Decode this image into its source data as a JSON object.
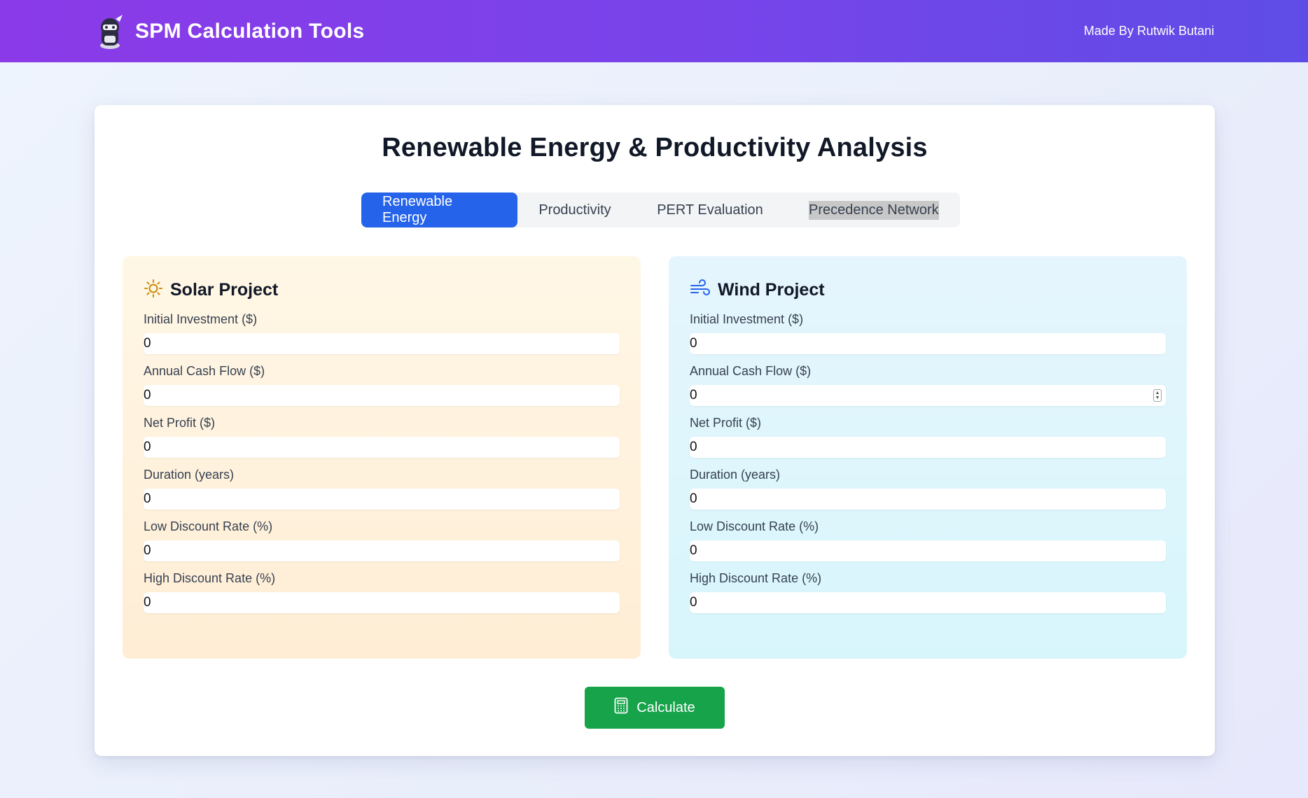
{
  "header": {
    "app_title": "SPM Calculation Tools",
    "made_by": "Made By Rutwik Butani"
  },
  "main": {
    "page_title": "Renewable Energy & Productivity Analysis",
    "tabs": [
      {
        "label": "Renewable Energy",
        "active": true
      },
      {
        "label": "Productivity",
        "active": false
      },
      {
        "label": "PERT Evaluation",
        "active": false
      },
      {
        "label": "Precedence Network",
        "active": false
      }
    ],
    "solar": {
      "title": "Solar Project",
      "icon": "sun-icon",
      "fields": [
        {
          "label": "Initial Investment ($)",
          "value": "0"
        },
        {
          "label": "Annual Cash Flow ($)",
          "value": "0"
        },
        {
          "label": "Net Profit ($)",
          "value": "0"
        },
        {
          "label": "Duration (years)",
          "value": "0"
        },
        {
          "label": "Low Discount Rate (%)",
          "value": "0"
        },
        {
          "label": "High Discount Rate (%)",
          "value": "0"
        }
      ]
    },
    "wind": {
      "title": "Wind Project",
      "icon": "wind-icon",
      "fields": [
        {
          "label": "Initial Investment ($)",
          "value": "0"
        },
        {
          "label": "Annual Cash Flow ($)",
          "value": "0"
        },
        {
          "label": "Net Profit ($)",
          "value": "0"
        },
        {
          "label": "Duration (years)",
          "value": "0"
        },
        {
          "label": "Low Discount Rate (%)",
          "value": "0"
        },
        {
          "label": "High Discount Rate (%)",
          "value": "0"
        }
      ]
    },
    "calculate_label": "Calculate"
  },
  "colors": {
    "header_start": "#8b3ae8",
    "header_end": "#5f4ce6",
    "active_tab": "#2563eb",
    "calculate_button": "#16a34a",
    "solar_panel": "#fff3e0",
    "wind_panel": "#e0f5fc"
  }
}
